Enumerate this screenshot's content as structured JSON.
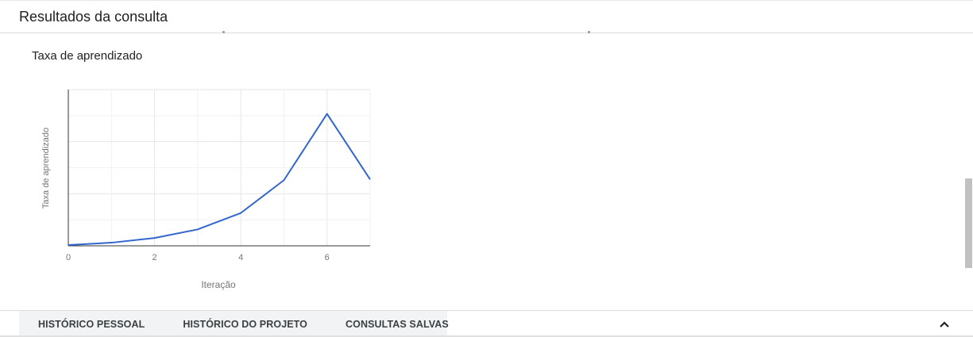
{
  "header": {
    "title": "Resultados da consulta"
  },
  "section": {
    "title": "Taxa de aprendizado"
  },
  "chart_data": {
    "type": "line",
    "title": "",
    "xlabel": "Iteração",
    "ylabel": "Taxa de aprendizado",
    "x_ticks": [
      0,
      2,
      4,
      6
    ],
    "xlim": [
      0,
      7
    ],
    "ylim": [
      0,
      1
    ],
    "grid": true,
    "series": [
      {
        "color": "#3366cc",
        "x": [
          0,
          1,
          2,
          3,
          4,
          5,
          6,
          7
        ],
        "y": [
          0.005,
          0.02,
          0.05,
          0.105,
          0.21,
          0.42,
          0.845,
          0.425
        ]
      }
    ]
  },
  "bottom_bar": {
    "tabs": [
      {
        "label": "HISTÓRICO PESSOAL"
      },
      {
        "label": "HISTÓRICO DO PROJETO"
      },
      {
        "label": "CONSULTAS SALVAS"
      }
    ],
    "collapse_icon": "chevron-up-icon"
  }
}
